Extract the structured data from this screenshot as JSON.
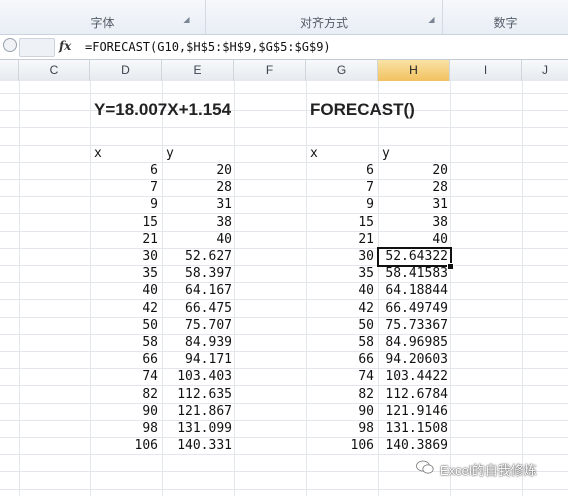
{
  "ribbon": {
    "groups": [
      {
        "label": "字体"
      },
      {
        "label": "对齐方式"
      },
      {
        "label": "数字"
      }
    ]
  },
  "formula_bar": {
    "fx_label": "fx",
    "formula": "=FORECAST(G10,$H$5:$H$9,$G$5:$G$9)"
  },
  "columns": [
    "C",
    "D",
    "E",
    "F",
    "G",
    "H",
    "I",
    "J"
  ],
  "active_column": "H",
  "left_table": {
    "title": "Y=18.007X+1.154",
    "header_x": "x",
    "header_y": "y",
    "rows": [
      [
        "6",
        "20"
      ],
      [
        "7",
        "28"
      ],
      [
        "9",
        "31"
      ],
      [
        "15",
        "38"
      ],
      [
        "21",
        "40"
      ],
      [
        "30",
        "52.627"
      ],
      [
        "35",
        "58.397"
      ],
      [
        "40",
        "64.167"
      ],
      [
        "42",
        "66.475"
      ],
      [
        "50",
        "75.707"
      ],
      [
        "58",
        "84.939"
      ],
      [
        "66",
        "94.171"
      ],
      [
        "74",
        "103.403"
      ],
      [
        "82",
        "112.635"
      ],
      [
        "90",
        "121.867"
      ],
      [
        "98",
        "131.099"
      ],
      [
        "106",
        "140.331"
      ]
    ]
  },
  "right_table": {
    "title": "FORECAST()",
    "header_x": "x",
    "header_y": "y",
    "rows": [
      [
        "6",
        "20"
      ],
      [
        "7",
        "28"
      ],
      [
        "9",
        "31"
      ],
      [
        "15",
        "38"
      ],
      [
        "21",
        "40"
      ],
      [
        "30",
        "52.64322"
      ],
      [
        "35",
        "58.41583"
      ],
      [
        "40",
        "64.18844"
      ],
      [
        "42",
        "66.49749"
      ],
      [
        "50",
        "75.73367"
      ],
      [
        "58",
        "84.96985"
      ],
      [
        "66",
        "94.20603"
      ],
      [
        "74",
        "103.4422"
      ],
      [
        "82",
        "112.6784"
      ],
      [
        "90",
        "121.9146"
      ],
      [
        "98",
        "131.1508"
      ],
      [
        "106",
        "140.3869"
      ]
    ]
  },
  "watermark": {
    "text": "Excel的自我修炼"
  }
}
